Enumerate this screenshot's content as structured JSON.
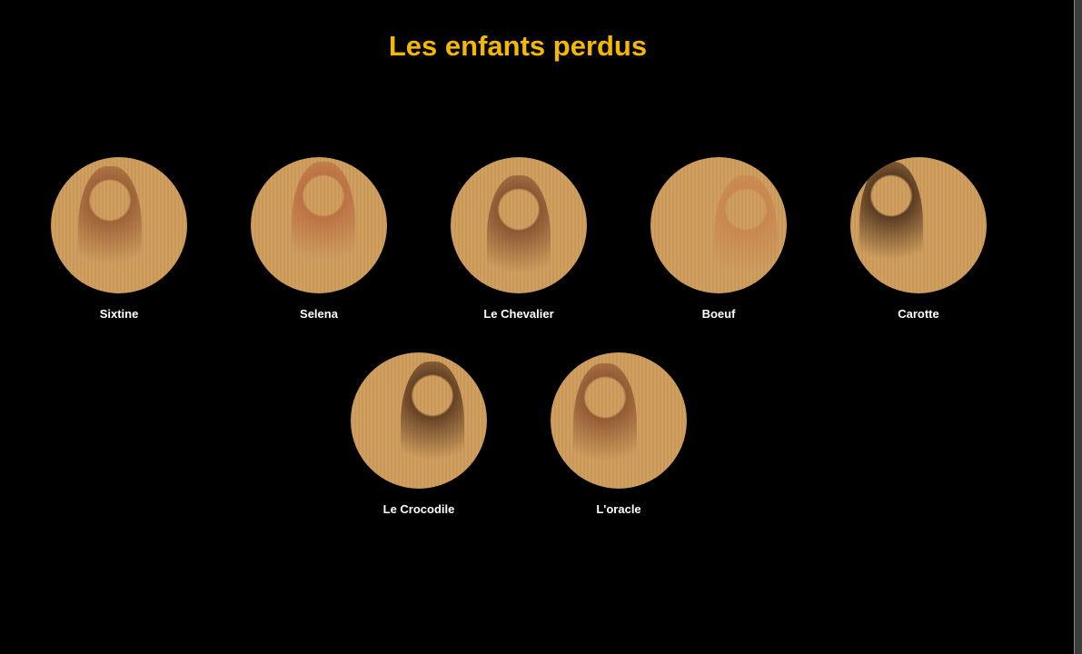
{
  "title": "Les enfants perdus",
  "characters": [
    {
      "name": "Sixtine",
      "tone": "#8a4a2a"
    },
    {
      "name": "Selena",
      "tone": "#b5603a"
    },
    {
      "name": "Le Chevalier",
      "tone": "#6e3a22"
    },
    {
      "name": "Boeuf",
      "tone": "#c77f4a"
    },
    {
      "name": "Carotte",
      "tone": "#2a140a"
    },
    {
      "name": "Le Crocodile",
      "tone": "#3a1c0e"
    },
    {
      "name": "L'oracle",
      "tone": "#7a4024"
    }
  ]
}
